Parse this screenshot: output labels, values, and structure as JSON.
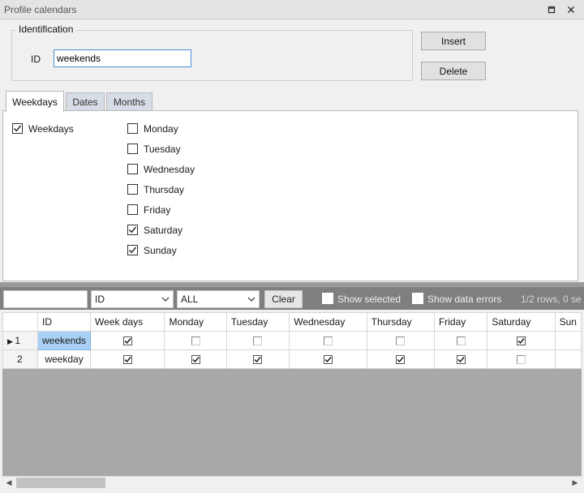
{
  "window": {
    "title": "Profile calendars"
  },
  "identification": {
    "legend": "Identification",
    "id_label": "ID",
    "id_value": "weekends"
  },
  "buttons": {
    "insert": "Insert",
    "delete": "Delete"
  },
  "tabs": [
    "Weekdays",
    "Dates",
    "Months"
  ],
  "weekdays_tab": {
    "weekdays_label": "Weekdays",
    "weekdays_checked": true,
    "days": [
      {
        "label": "Monday",
        "checked": false
      },
      {
        "label": "Tuesday",
        "checked": false
      },
      {
        "label": "Wednesday",
        "checked": false
      },
      {
        "label": "Thursday",
        "checked": false
      },
      {
        "label": "Friday",
        "checked": false
      },
      {
        "label": "Saturday",
        "checked": true
      },
      {
        "label": "Sunday",
        "checked": true
      }
    ]
  },
  "filter": {
    "column_select": "ID",
    "scope_select": "ALL",
    "clear_label": "Clear",
    "show_selected_label": "Show selected",
    "show_data_errors_label": "Show data errors",
    "rows_info": "1/2 rows, 0 se"
  },
  "grid": {
    "columns": [
      "ID",
      "Week days",
      "Monday",
      "Tuesday",
      "Wednesday",
      "Thursday",
      "Friday",
      "Saturday",
      "Sun"
    ],
    "rows": [
      {
        "num": "1",
        "id": "weekends",
        "current": true,
        "values": [
          true,
          false,
          false,
          false,
          false,
          false,
          true
        ]
      },
      {
        "num": "2",
        "id": "weekday",
        "current": false,
        "values": [
          true,
          true,
          true,
          true,
          true,
          true,
          false
        ]
      }
    ]
  },
  "colors": {
    "selected_cell": "#a9d1f5",
    "tab_inactive": "#d6dde6",
    "filter_bar": "#7f7f7f",
    "grid_empty": "#a8a8a8"
  }
}
